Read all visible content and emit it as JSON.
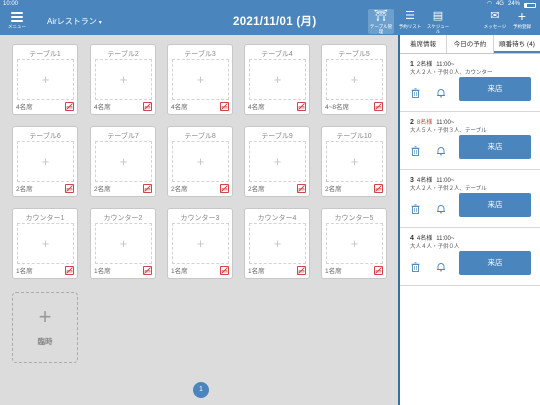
{
  "status": {
    "time": "10:00",
    "signal": "4G",
    "battery": "24%"
  },
  "nav": {
    "menu_label": "メニュー",
    "store_name": "Airレストラン",
    "store_caret": "▾",
    "date": "2021/11/01 (月)",
    "tools": [
      {
        "label": "テーブル管理",
        "icon": "table-icon",
        "active": true
      },
      {
        "label": "予約リスト",
        "icon": "list-icon"
      },
      {
        "label": "スケジュール",
        "icon": "schedule-icon"
      },
      {
        "label": "メッセージ",
        "icon": "mail-icon"
      },
      {
        "label": "予約登録",
        "icon": "plus-icon"
      }
    ]
  },
  "tables": [
    {
      "name": "テーブル1",
      "seats": "4名席"
    },
    {
      "name": "テーブル2",
      "seats": "4名席"
    },
    {
      "name": "テーブル3",
      "seats": "4名席"
    },
    {
      "name": "テーブル4",
      "seats": "4名席"
    },
    {
      "name": "テーブル5",
      "seats": "4~8名席"
    },
    {
      "name": "テーブル6",
      "seats": "2名席"
    },
    {
      "name": "テーブル7",
      "seats": "2名席"
    },
    {
      "name": "テーブル8",
      "seats": "2名席"
    },
    {
      "name": "テーブル9",
      "seats": "2名席"
    },
    {
      "name": "テーブル10",
      "seats": "2名席"
    },
    {
      "name": "カウンター1",
      "seats": "1名席"
    },
    {
      "name": "カウンター2",
      "seats": "1名席"
    },
    {
      "name": "カウンター3",
      "seats": "1名席"
    },
    {
      "name": "カウンター4",
      "seats": "1名席"
    },
    {
      "name": "カウンター5",
      "seats": "1名席"
    }
  ],
  "card_plus": "+",
  "temp_seat": {
    "plus": "+",
    "label": "臨時"
  },
  "page": "1",
  "panel": {
    "tabs": [
      "着席情報",
      "今日の予約",
      "順番待ち (4)"
    ],
    "visit_label": "来店",
    "waiting": [
      {
        "num": "1",
        "party": "2名様",
        "time": "11:00~",
        "detail": "大人２人・子供０人、カウンター",
        "warn": false
      },
      {
        "num": "2",
        "party": "8名様",
        "time": "11:00~",
        "detail": "大人５人・子供３人、テーブル",
        "warn": true
      },
      {
        "num": "3",
        "party": "4名様",
        "time": "11:00~",
        "detail": "大人２人・子供２人、テーブル",
        "warn": false
      },
      {
        "num": "4",
        "party": "4名様",
        "time": "11:00~",
        "detail": "大人４人・子供０人",
        "warn": false
      }
    ]
  },
  "colors": {
    "accent": "#4a86bd",
    "warning": "#d04545",
    "background": "#dcdcdc"
  }
}
